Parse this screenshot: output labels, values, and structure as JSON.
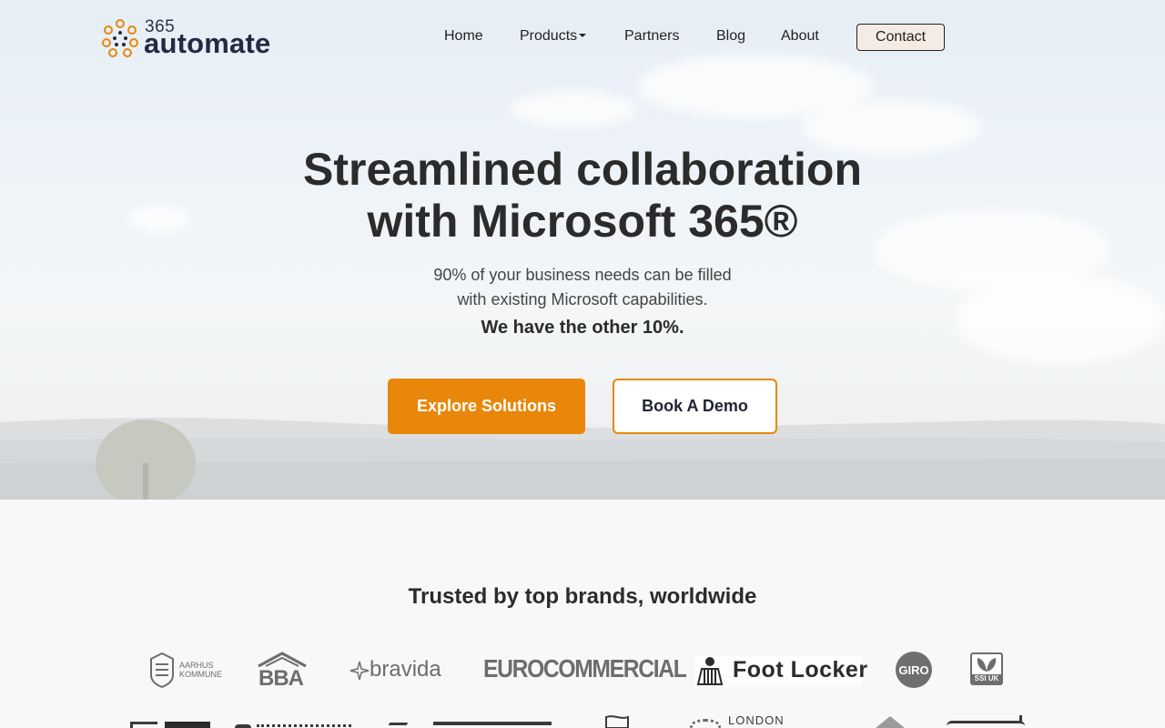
{
  "logo": {
    "prefix": "365",
    "name": "automate"
  },
  "nav": {
    "items": [
      {
        "label": "Home"
      },
      {
        "label": "Products"
      },
      {
        "label": "Partners"
      },
      {
        "label": "Blog"
      },
      {
        "label": "About"
      }
    ],
    "contact_label": "Contact"
  },
  "hero": {
    "title_line1": "Streamlined collaboration",
    "title_line2": "with Microsoft 365®",
    "subtitle_line1": "90% of your business needs can be filled",
    "subtitle_line2": "with existing Microsoft capabilities.",
    "strong": "We have the other 10%.",
    "primary_button": "Explore Solutions",
    "secondary_button": "Book A Demo"
  },
  "trusted": {
    "title": "Trusted by top brands, worldwide",
    "brands_row1": [
      {
        "name": "AARHUS",
        "name2": "KOMMUNE"
      },
      {
        "name": "BBA"
      },
      {
        "name": "bravida"
      },
      {
        "name": "EUROCOMMERCIAL"
      },
      {
        "name": "Foot Locker"
      },
      {
        "name": "GIRO"
      },
      {
        "name": "SSI UK"
      }
    ],
    "brands_row2": [
      {
        "name": "LONDON"
      }
    ]
  },
  "colors": {
    "accent": "#e8870a",
    "navy": "#242a44",
    "contact_bg": "#f4ebe4",
    "section_bg": "#f6f8fa"
  }
}
